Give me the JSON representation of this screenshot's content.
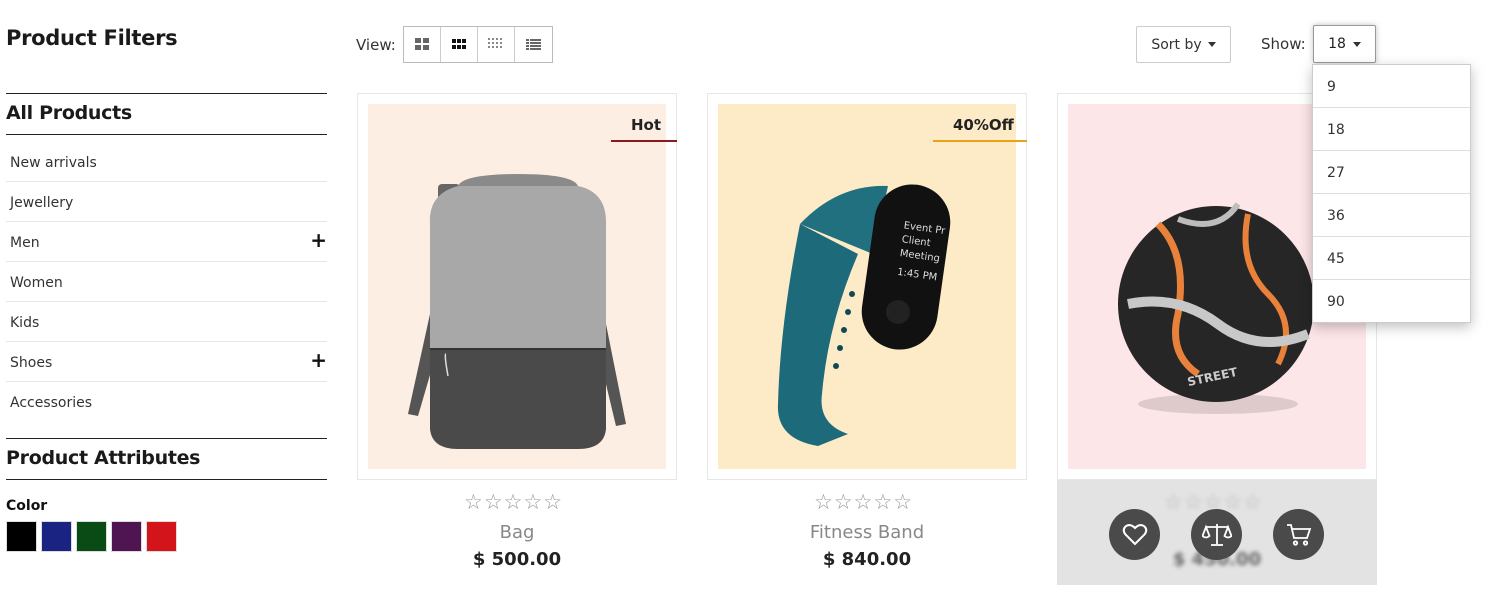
{
  "sidebar": {
    "title": "Product Filters",
    "all_products": "All Products",
    "categories": [
      {
        "label": "New arrivals",
        "expandable": false
      },
      {
        "label": "Jewellery",
        "expandable": false
      },
      {
        "label": "Men",
        "expandable": true
      },
      {
        "label": "Women",
        "expandable": false
      },
      {
        "label": "Kids",
        "expandable": false
      },
      {
        "label": "Shoes",
        "expandable": true
      },
      {
        "label": "Accessories",
        "expandable": false
      }
    ],
    "expand_symbol": "+",
    "attributes_title": "Product Attributes",
    "color_label": "Color",
    "colors": [
      "#000000",
      "#1a2282",
      "#0a4a14",
      "#4f1452",
      "#d3141b"
    ]
  },
  "toolbar": {
    "view_label": "View:",
    "view_modes": [
      "grid-2-icon",
      "grid-3-icon",
      "grid-4-icon",
      "list-icon"
    ],
    "active_view": 1,
    "sort_label": "Sort by",
    "show_label": "Show:",
    "show_value": "18",
    "show_options": [
      "9",
      "18",
      "27",
      "36",
      "45",
      "90"
    ]
  },
  "products": [
    {
      "name": "Bag",
      "price": "$ 500.00",
      "badge": "Hot",
      "badge_color": "#8b1a1a",
      "bg": "#fdeee3",
      "rating": 0
    },
    {
      "name": "Fitness Band",
      "price": "$ 840.00",
      "badge": "40%Off",
      "badge_color": "#e8a21c",
      "bg": "#fdebc8",
      "rating": 0
    },
    {
      "name": "",
      "price": "$ 450.00",
      "badge": "",
      "badge_color": "",
      "bg": "#fde6e8",
      "rating": 0
    }
  ],
  "actions": [
    "heart-icon",
    "compare-icon",
    "cart-icon"
  ],
  "stars_glyph": "☆☆☆☆☆",
  "watch_text": [
    "Event Pr",
    "Client",
    "Meeting",
    "1:45 PM"
  ],
  "ball_text": "STREET"
}
